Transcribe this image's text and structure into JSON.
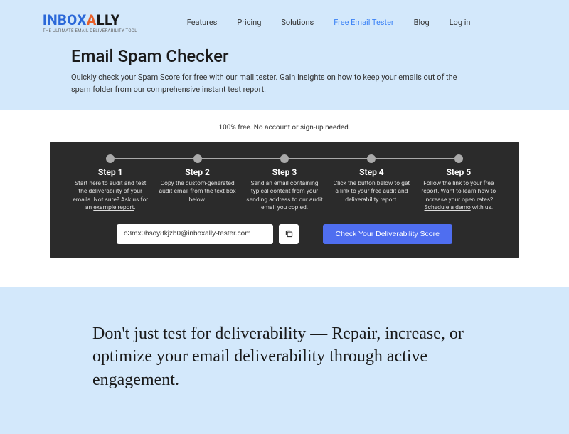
{
  "logo": {
    "inbox": "INBOX",
    "a": "A",
    "lly": "LLY",
    "tagline": "THE ULTIMATE EMAIL DELIVERABILITY TOOL"
  },
  "nav": {
    "items": [
      "Features",
      "Pricing",
      "Solutions",
      "Free Email Tester",
      "Blog",
      "Log in"
    ],
    "active_index": 3
  },
  "page": {
    "title": "Email Spam Checker",
    "subtitle": "Quickly check your Spam Score for free with our mail tester. Gain insights on how to keep your emails out of the spam folder from our comprehensive instant test report."
  },
  "free_text": "100% free. No account or sign-up needed.",
  "steps": [
    {
      "title": "Step 1",
      "desc": "Start here to audit and test the deliverability of your emails. Not sure? Ask us for an example report.",
      "underline": "example report"
    },
    {
      "title": "Step 2",
      "desc": "Copy the custom-generated audit email from the text box below."
    },
    {
      "title": "Step 3",
      "desc": "Send an email containing typical content from your sending address to our audit email you copied."
    },
    {
      "title": "Step 4",
      "desc": "Click the button below to get a link to your free audit and deliverability report."
    },
    {
      "title": "Step 5",
      "desc": "Follow the link to your free report. Want to learn how to increase your open rates? Schedule a demo with us.",
      "underline": "Schedule a demo"
    }
  ],
  "action": {
    "email_value": "o3mx0hsoy8kjzb0@inboxally-tester.com",
    "check_label": "Check Your Deliverability Score"
  },
  "value_prop": {
    "headline": "Don't just test for deliverability — Repair, increase, or optimize your email deliverability through active engagement."
  }
}
